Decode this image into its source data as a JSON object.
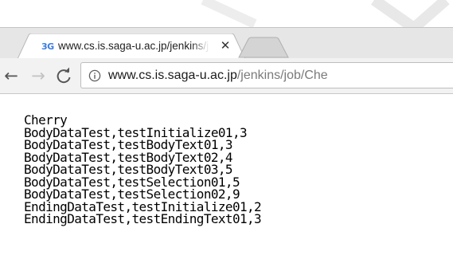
{
  "browser": {
    "tab": {
      "favicon": "3G",
      "title": "www.cs.is.saga-u.ac.jp/jenkins/job/Cherry",
      "close_icon": "close-icon"
    },
    "new_tab_icon": "new-tab-icon"
  },
  "toolbar": {
    "back": "←",
    "forward": "→",
    "reload_icon": "reload-icon",
    "info_icon": "info-icon",
    "url_host": "www.cs.is.saga-u.ac.jp",
    "url_path": "/jenkins/job/Che"
  },
  "content": {
    "lines": [
      "Cherry",
      "BodyDataTest,testInitialize01,3",
      "BodyDataTest,testBodyText01,3",
      "BodyDataTest,testBodyText02,4",
      "BodyDataTest,testBodyText03,5",
      "BodyDataTest,testSelection01,5",
      "BodyDataTest,testSelection02,9",
      "EndingDataTest,testInitialize01,2",
      "EndingDataTest,testEndingText01,3"
    ]
  },
  "colors": {
    "favicon": "#3b7de0",
    "url_path": "#7a7a7a",
    "toolbar_bg": "#f2f2f2"
  }
}
